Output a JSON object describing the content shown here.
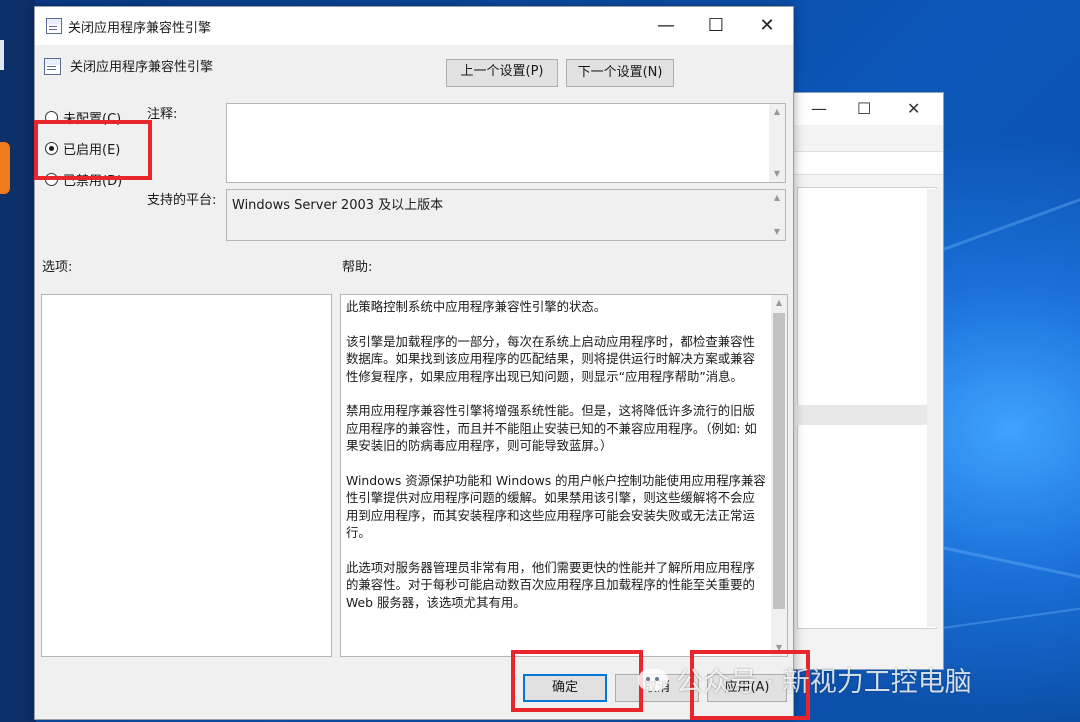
{
  "dialog": {
    "title": "关闭应用程序兼容性引擎",
    "minimize_glyph": "—",
    "maximize_glyph": "☐",
    "close_glyph": "✕",
    "policy_name": "关闭应用程序兼容性引擎",
    "prev_button": "上一个设置(P)",
    "next_button": "下一个设置(N)",
    "radios": [
      {
        "label": "未配置(C)",
        "selected": false
      },
      {
        "label": "已启用(E)",
        "selected": true
      },
      {
        "label": "已禁用(D)",
        "selected": false
      }
    ],
    "comment_label": "注释:",
    "comment_value": "",
    "platform_label": "支持的平台:",
    "platform_value": "Windows Server 2003 及以上版本",
    "options_label": "选项:",
    "help_label": "帮助:",
    "help_paragraphs": [
      "此策略控制系统中应用程序兼容性引擎的状态。",
      "该引擎是加载程序的一部分，每次在系统上启动应用程序时，都检查兼容性数据库。如果找到该应用程序的匹配结果，则将提供运行时解决方案或兼容性修复程序，如果应用程序出现已知问题，则显示“应用程序帮助”消息。",
      "禁用应用程序兼容性引擎将增强系统性能。但是，这将降低许多流行的旧版应用程序的兼容性，而且并不能阻止安装已知的不兼容应用程序。（例如: 如果安装旧的防病毒应用程序，则可能导致蓝屏。）",
      "Windows 资源保护功能和 Windows 的用户帐户控制功能使用应用程序兼容性引擎提供对应用程序问题的缓解。如果禁用该引擎，则这些缓解将不会应用到应用程序，而其安装程序和这些应用程序可能会安装失败或无法正常运行。",
      "此选项对服务器管理员非常有用，他们需要更快的性能并了解所用应用程序的兼容性。对于每秒可能启动数百次应用程序且加载程序的性能至关重要的 Web 服务器，该选项尤其有用。"
    ],
    "ok_button": "确定",
    "cancel_button": "取消",
    "apply_button": "应用(A)"
  },
  "background_window": {
    "minimize_glyph": "—",
    "maximize_glyph": "☐",
    "close_glyph": "✕"
  },
  "watermark": {
    "text": "公众号 · 新视力工控电脑",
    "icon": "wechat-icon"
  },
  "colors": {
    "highlight_red": "#e8262c",
    "focus_blue": "#0078d7",
    "desktop_blue": "#0b4fa0"
  }
}
